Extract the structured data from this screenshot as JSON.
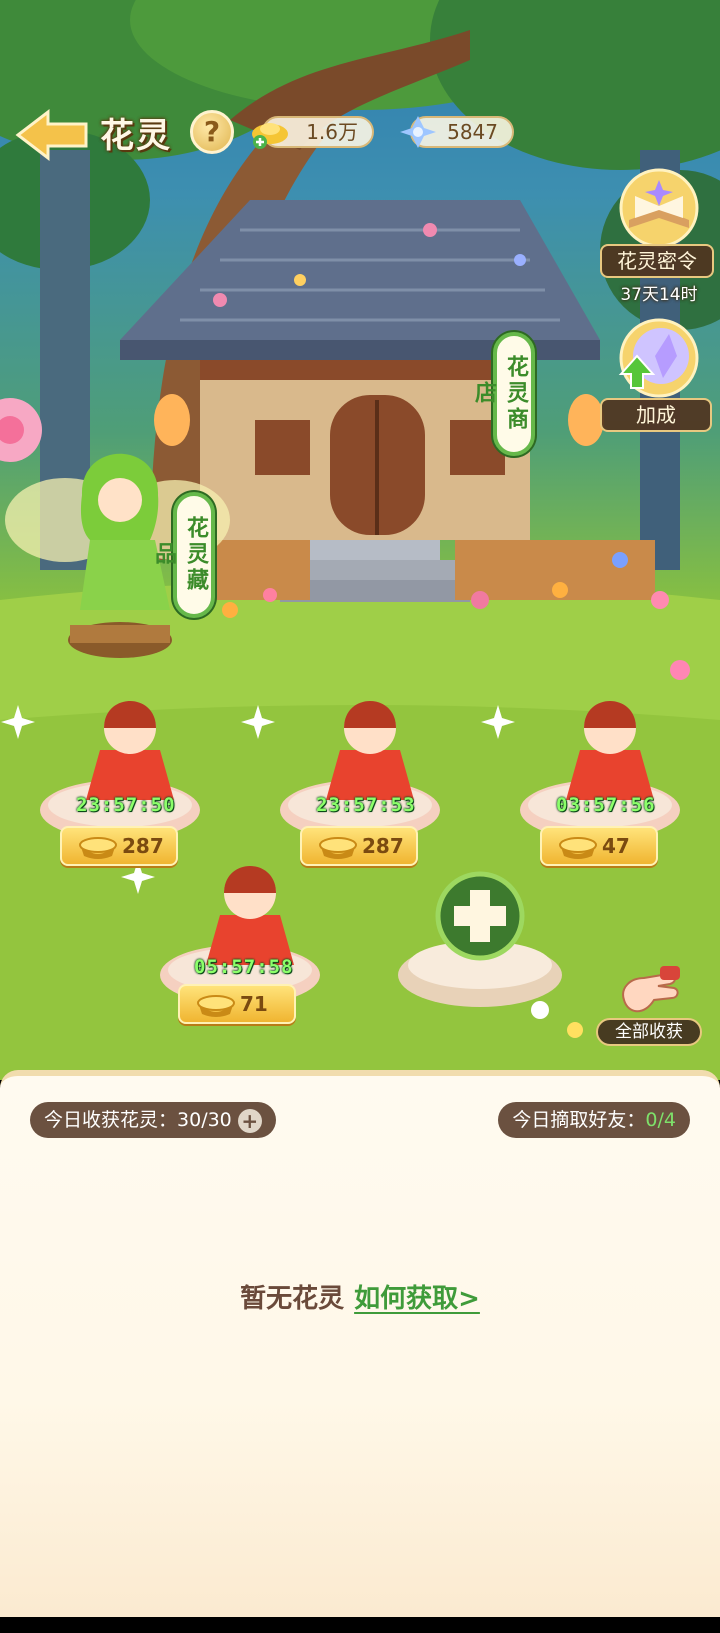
{
  "header": {
    "title": "花灵",
    "help": "?",
    "gold": "1.6万",
    "crystal": "5847"
  },
  "side": {
    "order_label": "花灵密令",
    "order_time": "37天14时",
    "bonus_label": "加成",
    "shop_label": "花灵商店",
    "collection_label": "花灵藏品",
    "collect_all_label": "全部收获"
  },
  "plots": [
    {
      "timer": "23:57:50",
      "reward": "287"
    },
    {
      "timer": "23:57:53",
      "reward": "287"
    },
    {
      "timer": "03:57:56",
      "reward": "47"
    },
    {
      "timer": "05:57:58",
      "reward": "71"
    }
  ],
  "panel": {
    "harvest_label": "今日收获花灵：",
    "harvest_value": "30/30",
    "friend_label": "今日摘取好友：",
    "friend_value": "0/4",
    "empty_text": "暂无花灵",
    "empty_link": "如何获取>"
  },
  "colors": {
    "accent_green": "#3f9b3a",
    "timer_green": "#8cff6a",
    "gold": "#f0b531"
  }
}
